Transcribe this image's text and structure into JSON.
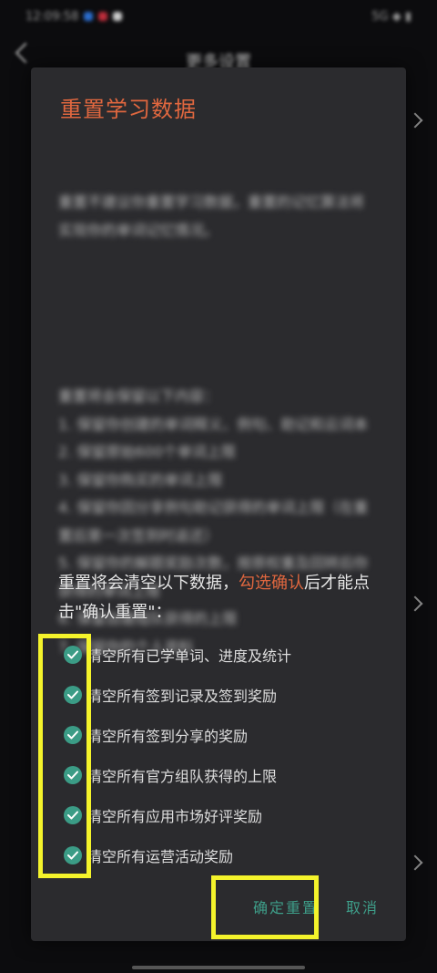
{
  "status_bar": {
    "time": "12:09:58",
    "right": "5G ◆ ▮"
  },
  "background_screen": {
    "title": "更多设置",
    "items": [
      "",
      "",
      "",
      "",
      ""
    ]
  },
  "dialog": {
    "title": "重置学习数据",
    "blurred_paragraph_1": "重置不建议你重置学习数据，重置的记忆算法将实现你的单词记忆情况。",
    "blurred_paragraph_2": "重置将会保留以下内容：\n1. 保留你创建的单词释义、例句、助记和云词本\n2. 保留原始600个单词上限\n3. 保留你购买的单词上限\n4. 保留你因分享例句助记获得的单词上限（在重置后第一次签到时返还）\n5. 保留你的解题奖励次数，按原权重及回转后你获得的单词上限\n6. 保留自建组队获得的上限\n7. 保留你的个人资料",
    "clear_intro_prefix": "重置将会清空以下数据，",
    "clear_intro_accent": "勾选确认",
    "clear_intro_suffix": "后才能点击\"确认重置\"：",
    "checklist": [
      "清空所有已学单词、进度及统计",
      "清空所有签到记录及签到奖励",
      "清空所有签到分享的奖励",
      "清空所有官方组队获得的上限",
      "清空所有应用市场好评奖励",
      "清空所有运营活动奖励"
    ],
    "confirm_label": "确定重置",
    "cancel_label": "取消"
  },
  "colors": {
    "accent": "#e0673f",
    "check": "#3b9c86",
    "button": "#3e9e89",
    "highlight": "#f4f32b"
  }
}
